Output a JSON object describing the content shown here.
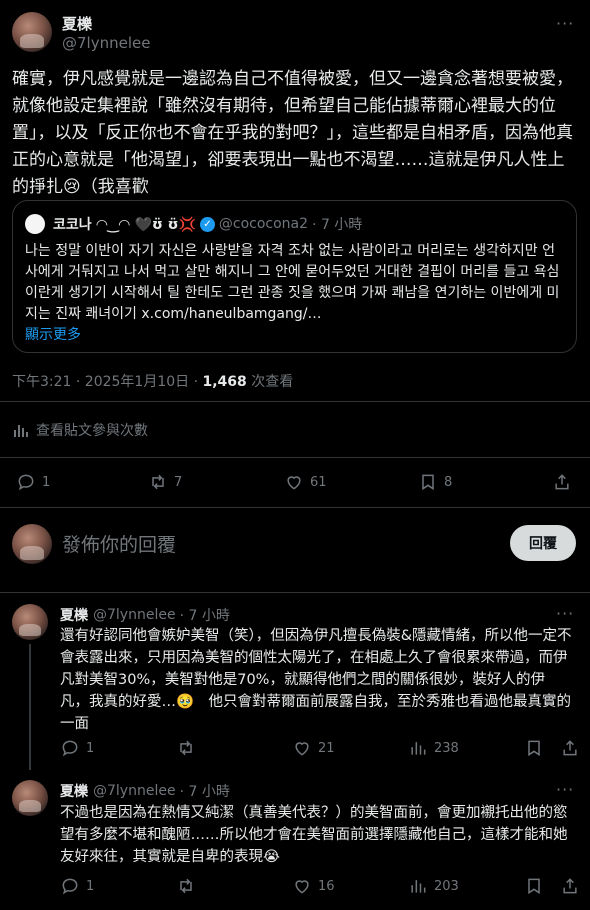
{
  "main_post": {
    "author_name": "夏櫟",
    "author_handle": "@7lynnelee",
    "text": "確實，伊凡感覺就是一邊認為自己不值得被愛，但又一邊貪念著想要被愛，就像他設定集裡說「雖然沒有期待，但希望自己能佔據蒂爾心裡最大的位置」，以及「反正你也不會在乎我的對吧？」，這些都是自相矛盾，因為他真正的心意就是「他渴望」，卻要表現出一點也不渴望……這就是伊凡人性上的掙扎😢（我喜歡",
    "timestamp": "下午3:21 · 2025年1月10日 · ",
    "views_count": "1,468",
    "views_label": " 次查看",
    "analytics_label": "查看貼文參與次數",
    "stats": {
      "replies": "1",
      "reposts": "7",
      "likes": "61",
      "bookmarks": "8"
    }
  },
  "quote": {
    "name": "코코나 ◠‿◠ 🖤ʊ̈ ʊ̈💢",
    "handle": "@cococona2",
    "time": "· 7 小時",
    "text": "나는 정말 이반이 자기 자신은 사랑받을 자격 조차 없는 사람이라고 머리로는 생각하지만 언사에게 거둬지고 나서 먹고 살만 해지니 그 안에 묻어두었던 거대한 결핍이 머리를 들고 욕심이란게 생기기 시작해서 틸 한테도 그런 관종 짓을 했으며 가짜 쾌남을 연기하는 이반에게 미지는 진짜 쾌녀이기 x.com/haneulbamgang/…",
    "show_more": "顯示更多"
  },
  "composer": {
    "placeholder": "發佈你的回覆",
    "button": "回覆"
  },
  "replies": [
    {
      "name": "夏櫟",
      "handle": "@7lynnelee",
      "time": "· 7 小時",
      "text": "還有好認同他會嫉妒美智（笑），但因為伊凡擅長偽裝&隱藏情緒，所以他一定不會表露出來，只用因為美智的個性太陽光了，在相處上久了會很累來帶過，而伊凡對美智30%，美智對他是70%，就顯得他們之間的關係很妙，裝好人的伊凡，我真的好愛…🥹　他只會對蒂爾面前展露自我，至於秀雅也看過他最真實的一面",
      "stats": {
        "replies": "1",
        "reposts": "",
        "likes": "21",
        "views": "238"
      }
    },
    {
      "name": "夏櫟",
      "handle": "@7lynnelee",
      "time": "· 7 小時",
      "text": "不過也是因為在熱情又純潔（真善美代表？）的美智面前，會更加襯托出他的慾望有多麼不堪和醜陋……所以他才會在美智面前選擇隱藏他自己，這樣才能和她友好來往，其實就是自卑的表現😭",
      "stats": {
        "replies": "1",
        "reposts": "",
        "likes": "16",
        "views": "203"
      }
    }
  ],
  "icons": [
    "more-icon",
    "reply-icon",
    "repost-icon",
    "like-icon",
    "bookmark-icon",
    "share-icon",
    "views-icon",
    "analytics-icon",
    "verified-icon"
  ]
}
